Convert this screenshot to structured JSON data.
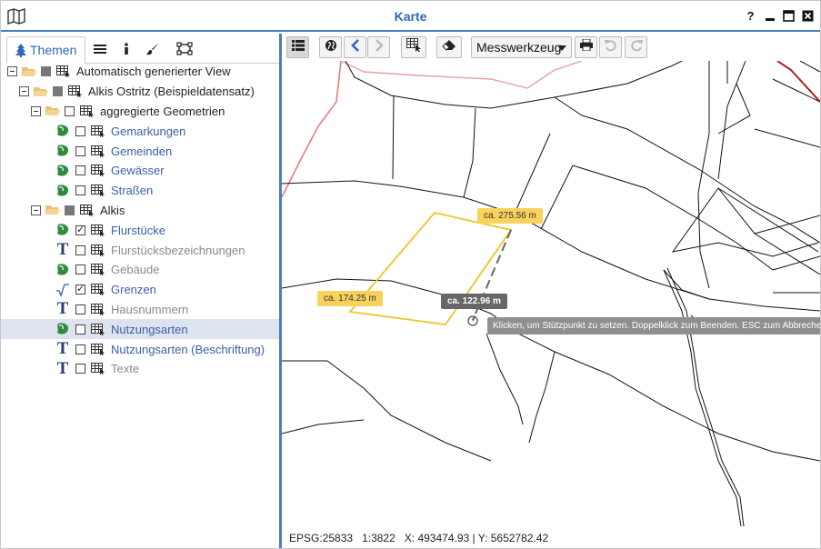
{
  "window": {
    "title": "Karte",
    "help_label": "?"
  },
  "tabs": {
    "themes_label": "Themen"
  },
  "tree": [
    {
      "label": "Automatisch generierter View"
    },
    {
      "label": "Alkis Ostritz (Beispieldatensatz)"
    },
    {
      "label": "aggregierte Geometrien"
    },
    {
      "label": "Gemarkungen",
      "checked": false
    },
    {
      "label": "Gemeinden",
      "checked": false
    },
    {
      "label": "Gewässer",
      "checked": false
    },
    {
      "label": "Straßen",
      "checked": false
    },
    {
      "label": "Alkis"
    },
    {
      "label": "Flurstücke",
      "checked": true
    },
    {
      "label": "Flurstücksbezeichnungen",
      "checked": false
    },
    {
      "label": "Gebäude",
      "checked": false
    },
    {
      "label": "Grenzen",
      "checked": true
    },
    {
      "label": "Hausnummern",
      "checked": false
    },
    {
      "label": "Nutzungsarten",
      "checked": false,
      "selected": true
    },
    {
      "label": "Nutzungsarten (Beschriftung)",
      "checked": false
    },
    {
      "label": "Texte",
      "checked": false
    }
  ],
  "toolbar": {
    "measure_tool_label": "Messwerkzeug"
  },
  "measure": {
    "segment1": "ca. 174.25 m",
    "segment2": "ca. 275.56 m",
    "current": "ca. 122.96 m",
    "hint": "Klicken, um Stützpunkt zu setzen. Doppelklick zum Beenden. ESC zum Abbrechen"
  },
  "status": {
    "epsg": "EPSG:25833",
    "scale": "1:3822",
    "coords": "X: 493474.93 | Y: 5652782.42"
  },
  "colors": {
    "accent": "#4a7cc9",
    "title": "#2e67b8",
    "link": "#3a5ea8",
    "measure": "#f8d25b",
    "boundary_red": "#e05050"
  }
}
